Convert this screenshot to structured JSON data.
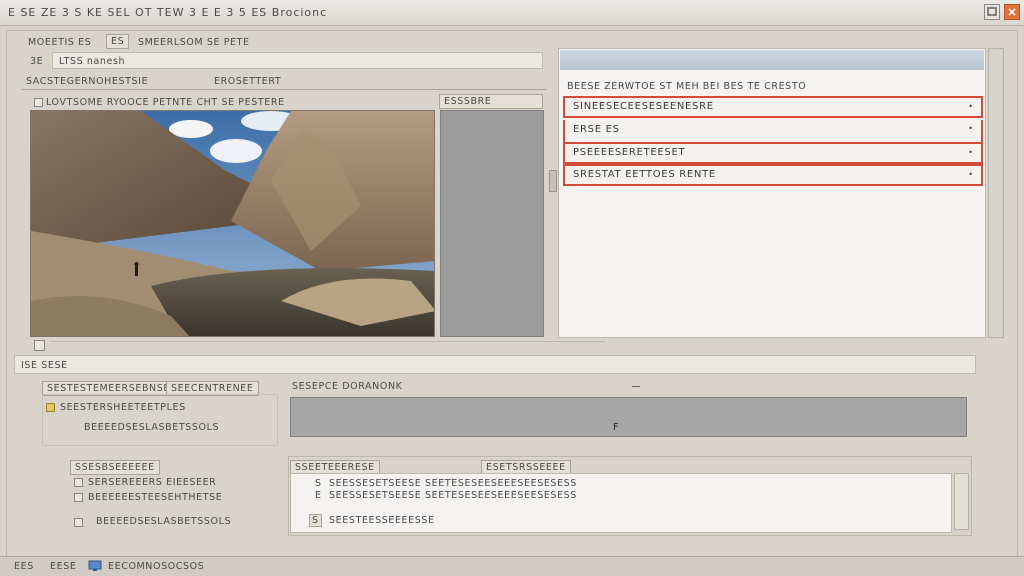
{
  "window": {
    "title": "E SE ZE 3 S KE SEL OT TEW 3 E E 3 5 ES Brocionc",
    "min_icon": "restore-icon",
    "close_icon": "close-icon",
    "accent": "#d24a3a"
  },
  "top": {
    "menu_label": "MOEETIS ES",
    "menu_badge": "ES",
    "menu_title": "SMEERLSOM SE PETE",
    "path_prefix": "3E",
    "path_value": "LTSS nanesh",
    "row_label": "SACSTEGERNOHESTSIE",
    "row_badge": "EROSETTERT"
  },
  "preview": {
    "header": "LOVTSOME RYOOCE PETNTE CHT SE PESTERE",
    "side_label": "ESSSBRE"
  },
  "right_panel": {
    "header": "BEESE ZERWTOE ST MEH BEI BES TE CRESTO",
    "rows": [
      "SINEESECEESESEENESRE",
      "ERSE ES",
      "PSEEEESERETEESET",
      "SRESTAT EETTOES RENTE"
    ]
  },
  "section2": {
    "label": "ISE SESE",
    "btn1": "SESTESTEMEERSEBNSE",
    "btn2": "SEECENTRENEE",
    "check_label": "SEESTERSHEETEETPLES",
    "sub_label": "BEEEEDSESLASBETSSOLS",
    "field_label": "SESEPCE DORANONK",
    "field_value": "F"
  },
  "section3": {
    "header1": "SSESBSEEEEEE",
    "check1": "SERSEREEERS EIEESEER",
    "check2": "BEEEEEESTEESEHTHETSE",
    "header2": "SSEETEEERESE",
    "header3": "ESETSRSSEEEE",
    "line1": "SEESSESETSEESE SEETESESEESEEESEESESESS",
    "line2": "SEESTEESSEEEESSE",
    "line1_prefix": "S",
    "line2_prefix": "E"
  },
  "status": {
    "item1": "EES",
    "item2": "EESE",
    "item3": "EECOMNOSOCSOS",
    "net_icon": "network-icon"
  }
}
